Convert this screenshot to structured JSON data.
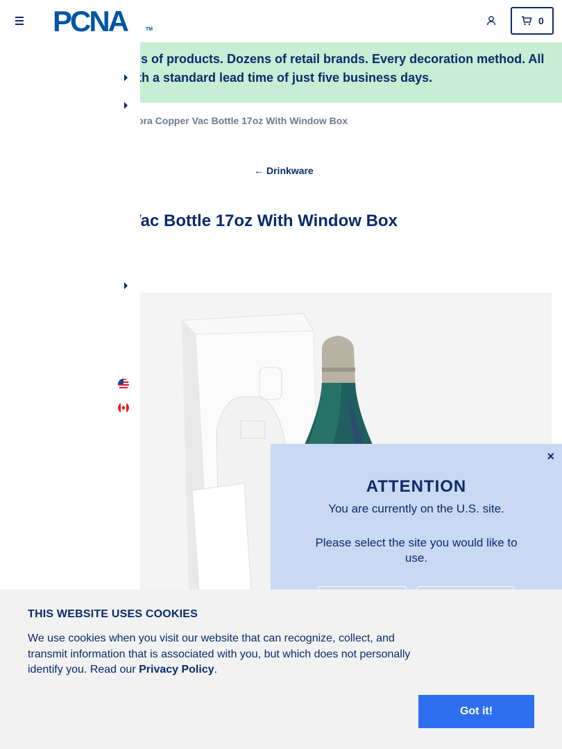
{
  "header": {
    "logo_text": "PCNA",
    "logo_tm": "TM",
    "cart_count": "0"
  },
  "banner": {
    "line1": "ls of products. Dozens of retail brands. Every decoration method. All",
    "line2": "th a standard lead time of just five business days."
  },
  "breadcrumb": "ora Copper Vac Bottle 17oz With Window Box",
  "back_link": {
    "arrow": "←",
    "label": "Drinkware"
  },
  "product": {
    "title": "Vac Bottle 17oz With Window Box"
  },
  "attention_modal": {
    "close": "×",
    "title": "ATTENTION",
    "message": "You are currently on the U.S. site.",
    "prompt": "Please select the site you would like to use."
  },
  "cookie_banner": {
    "title": "THIS WEBSITE USES COOKIES",
    "text": "We use cookies when you visit our website that can recognize, collect, and transmit information that is associated with you, but which does not personally identify you. Read our ",
    "link": "Privacy Policy",
    "period": ".",
    "button": "Got it!"
  },
  "colors": {
    "navy": "#0b2a6b",
    "brand_blue": "#0055a5",
    "banner_green": "#c6eed4",
    "modal_blue": "#c9d9f2",
    "cookie_button": "#2d6ff0"
  }
}
